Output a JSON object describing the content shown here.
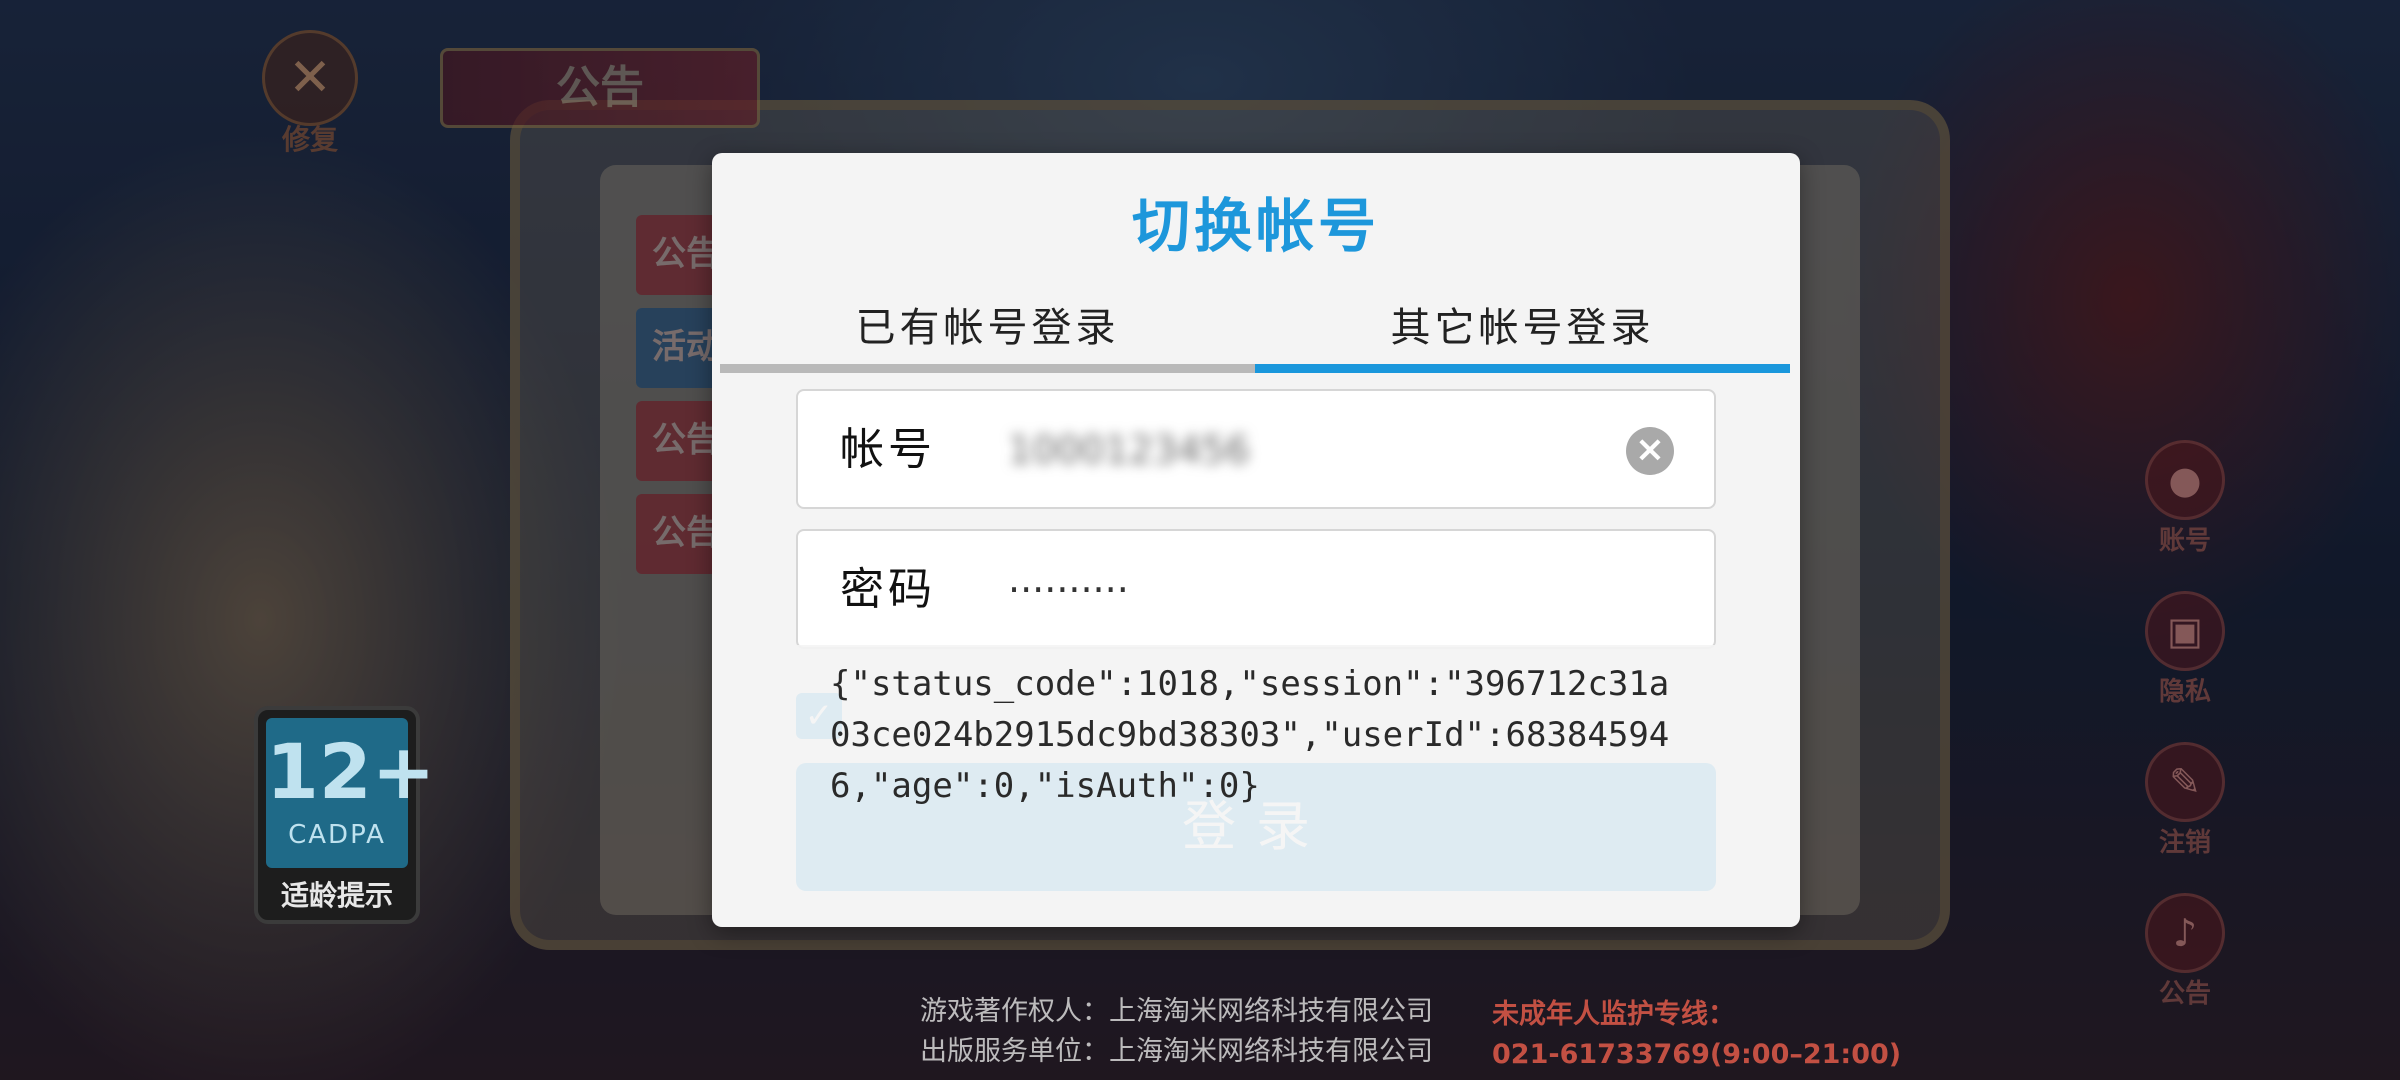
{
  "background": {
    "repair_label": "修复",
    "notice_banner": "公告",
    "notice_tabs": [
      "公告",
      "活动",
      "公告",
      "公告"
    ],
    "right_menu": [
      {
        "icon": "user-icon",
        "label": "账号"
      },
      {
        "icon": "lock-icon",
        "label": "隐私"
      },
      {
        "icon": "pen-icon",
        "label": "注销"
      },
      {
        "icon": "bell-icon",
        "label": "公告"
      }
    ],
    "age_badge": {
      "rating": "12+",
      "org": "CADPA",
      "tip": "适龄提示"
    },
    "footer": {
      "copyright_owner": "游戏著作权人：上海淘米网络科技有限公司",
      "publisher": "出版服务单位：上海淘米网络科技有限公司",
      "hotline_label": "未成年人监护专线：",
      "hotline_number": "021-61733769(9:00–21:00)"
    }
  },
  "dialog": {
    "title": "切换帐号",
    "tabs": [
      {
        "label": "已有帐号登录",
        "active": false
      },
      {
        "label": "其它帐号登录",
        "active": true
      }
    ],
    "account_field": {
      "label": "帐号",
      "value": "1000123456"
    },
    "password_field": {
      "label": "密码",
      "value": "··········"
    },
    "login_button": "登录",
    "toast": "{\"status_code\":1018,\"session\":\"396712c31a03ce024b2915dc9bd38303\",\"userId\":683845946,\"age\":0,\"isAuth\":0}"
  },
  "colors": {
    "accent": "#1a97dc",
    "dialog_bg": "#f4f4f4",
    "tab_inactive_line": "#b9b9b9"
  }
}
